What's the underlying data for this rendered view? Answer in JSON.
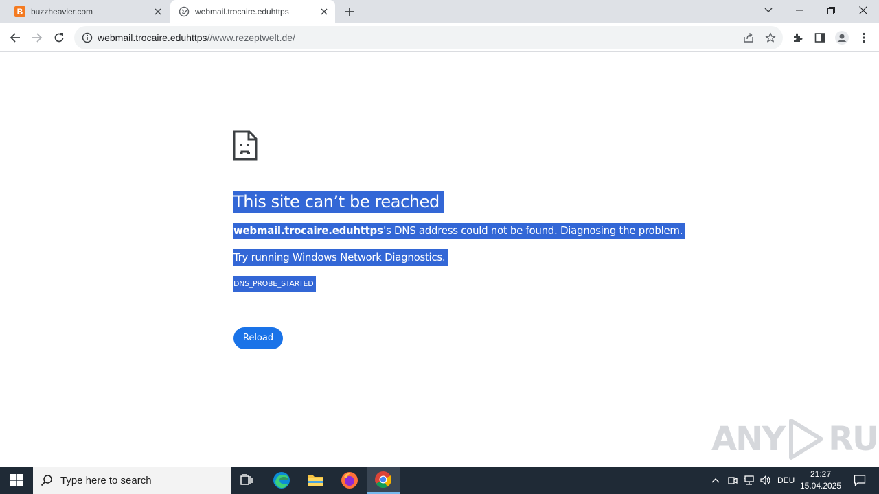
{
  "browser": {
    "tabs": [
      {
        "title": "buzzheavier.com",
        "favicon": "B"
      },
      {
        "title": "webmail.trocaire.eduhttps"
      }
    ],
    "address_bar": {
      "host": "webmail.trocaire.eduhttps",
      "rest": "//www.rezeptwelt.de/"
    }
  },
  "error_page": {
    "title": "This site can’t be reached",
    "host": "webmail.trocaire.eduhttps",
    "description_rest": "’s DNS address could not be found. Diagnosing the problem.",
    "suggestion": "Try running Windows Network Diagnostics.",
    "error_code": "DNS_PROBE_STARTED",
    "reload_label": "Reload"
  },
  "watermark": {
    "left": "ANY",
    "right": "RUN"
  },
  "taskbar": {
    "search_placeholder": "Type here to search",
    "language": "DEU",
    "time": "21:27",
    "date": "15.04.2025"
  },
  "colors": {
    "selection": "#3367d6",
    "reload_button": "#1a73e8",
    "tabstrip": "#dee1e6",
    "taskbar": "#1f2a36"
  }
}
